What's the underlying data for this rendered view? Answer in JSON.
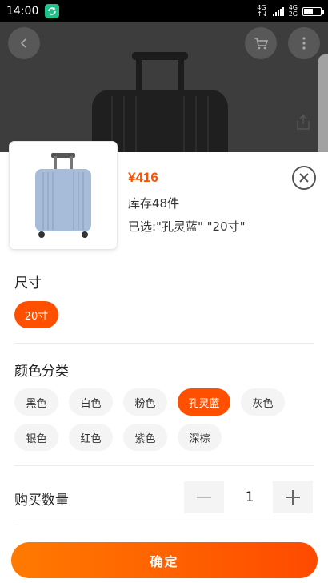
{
  "status_bar": {
    "time": "14:00",
    "net_top": "4G",
    "net_top2": "4G",
    "net_bottom2": "2G",
    "battery_level": 0.55
  },
  "product": {
    "price": "¥416",
    "stock": "库存48件",
    "selected": "已选:\"孔灵蓝\" \"20寸\""
  },
  "size": {
    "title": "尺寸",
    "options": [
      "20寸"
    ],
    "selected": "20寸"
  },
  "color": {
    "title": "颜色分类",
    "options": [
      "黑色",
      "白色",
      "粉色",
      "孔灵蓝",
      "灰色",
      "银色",
      "红色",
      "紫色",
      "深棕"
    ],
    "selected": "孔灵蓝"
  },
  "quantity": {
    "label": "购买数量",
    "value": "1",
    "minus": "−",
    "plus": "+"
  },
  "confirm_label": "确定",
  "colors": {
    "accent": "#ff5000",
    "chip_bg": "#f4f4f4",
    "suitcase_blue": "#a7bcd8"
  }
}
